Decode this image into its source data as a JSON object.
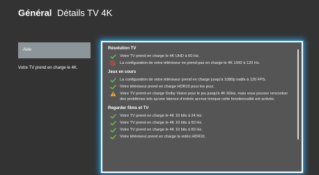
{
  "header": {
    "category": "Général",
    "page_title": "Détails TV 4K"
  },
  "help_button_label": "Aide",
  "left_summary": "Votre TV prend en charge le 4K.",
  "colors": {
    "ok": "#6cc24a",
    "error": "#e0483c",
    "warning": "#f2b62f",
    "focus": "#3aa0e0"
  },
  "sections": [
    {
      "title": "Résolution TV",
      "items": [
        {
          "status": "ok",
          "icon": "check-icon",
          "text": "Votre TV prend en charge le 4K UHD à 60 Hz."
        },
        {
          "status": "error",
          "icon": "blocked-icon",
          "text": "La configuration de votre téléviseur ne prend pas en charge le 4K UHD à 120 Hz."
        }
      ]
    },
    {
      "title": "Jeux en cours",
      "items": [
        {
          "status": "ok",
          "icon": "check-icon",
          "text": "La configuration de votre téléviseur prend en charge jusqu'à 1080p natifs à 120 FPS."
        },
        {
          "status": "ok",
          "icon": "check-icon",
          "text": "Votre téléviseur prend en charge HDR10 pour les jeux."
        },
        {
          "status": "warning",
          "icon": "warning-icon",
          "text": "Votre TV prend en charge Dolby Vision pour le jeu jusqu'à 4K 60Hz, mais vous pouvez rencontrer des problèmes tels qu'une latence d'entrée accrue lorsque cette fonctionnalité est activée."
        }
      ]
    },
    {
      "title": "Regarder films et TV",
      "items": [
        {
          "status": "ok",
          "icon": "check-icon",
          "text": "Votre TV prend en charge le 4K 10 bits à 24 Hz."
        },
        {
          "status": "ok",
          "icon": "check-icon",
          "text": "Votre TV prend en charge le 4K 10 bits à 50 Hz."
        },
        {
          "status": "ok",
          "icon": "check-icon",
          "text": "Votre TV prend en charge le 4K 10 bits à 60 Hz."
        },
        {
          "status": "ok",
          "icon": "check-icon",
          "text": "Votre téléviseur prend en charge la vidéo HDR10."
        }
      ]
    }
  ]
}
